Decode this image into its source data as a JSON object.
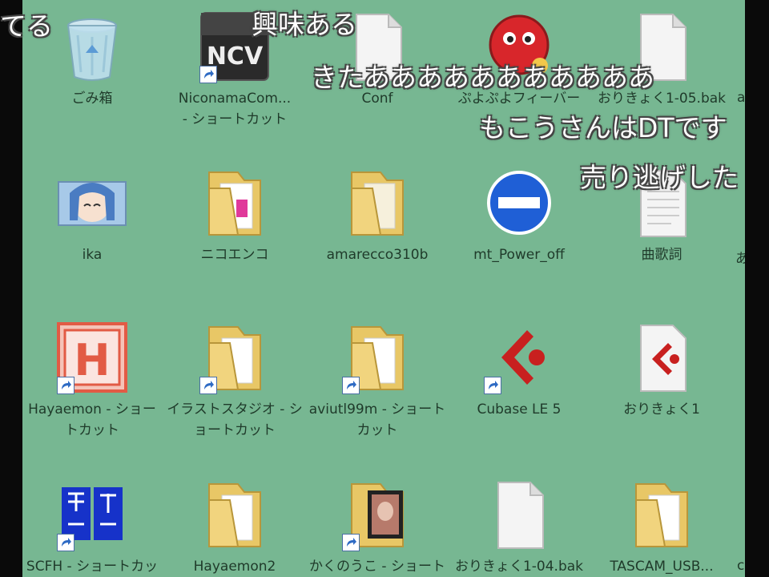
{
  "icons": [
    {
      "label": "ごみ箱",
      "icon": "recycle-bin-icon"
    },
    {
      "label": "NiconamaCom...\n- ショートカット",
      "icon": "ncv-app-icon"
    },
    {
      "label": "Conf",
      "icon": "document-icon"
    },
    {
      "label": "ぷよぷよフィーバー",
      "icon": "puyo-game-icon"
    },
    {
      "label": "おりきょく1-05.bak",
      "icon": "document-icon"
    },
    {
      "label": "ika",
      "icon": "anime-image-icon"
    },
    {
      "label": "ニコエンコ",
      "icon": "folder-icon"
    },
    {
      "label": "amarecco310b",
      "icon": "folder-icon"
    },
    {
      "label": "mt_Power_off",
      "icon": "no-entry-icon"
    },
    {
      "label": "曲歌詞",
      "icon": "text-document-icon"
    },
    {
      "label": "Hayaemon - ショートカット",
      "icon": "hayaemon-app-icon"
    },
    {
      "label": "イラストスタジオ - ショートカット",
      "icon": "folder-icon"
    },
    {
      "label": "aviutl99m - ショートカット",
      "icon": "folder-icon"
    },
    {
      "label": "Cubase LE 5",
      "icon": "cubase-app-icon"
    },
    {
      "label": "おりきょく1",
      "icon": "cubase-document-icon"
    },
    {
      "label": "SCFH - ショートカッ",
      "icon": "scfh-app-icon"
    },
    {
      "label": "Hayaemon2",
      "icon": "folder-icon"
    },
    {
      "label": "かくのうこ - ショート",
      "icon": "picture-icon"
    },
    {
      "label": "おりきょく1-04.bak",
      "icon": "document-icon"
    },
    {
      "label": "TASCAM_USB...",
      "icon": "folder-icon"
    }
  ],
  "comments": [
    {
      "text": "てる"
    },
    {
      "text": "興味ある"
    },
    {
      "text": "きたあああああああああああ"
    },
    {
      "text": "もこうさんはDTです"
    },
    {
      "text": "売り逃げした"
    }
  ],
  "edge_labels": [
    "a",
    "あ",
    "c"
  ],
  "colors": {
    "desktop": "#77b792",
    "folder": "#e8c766",
    "comment_text": "#ffffff"
  }
}
